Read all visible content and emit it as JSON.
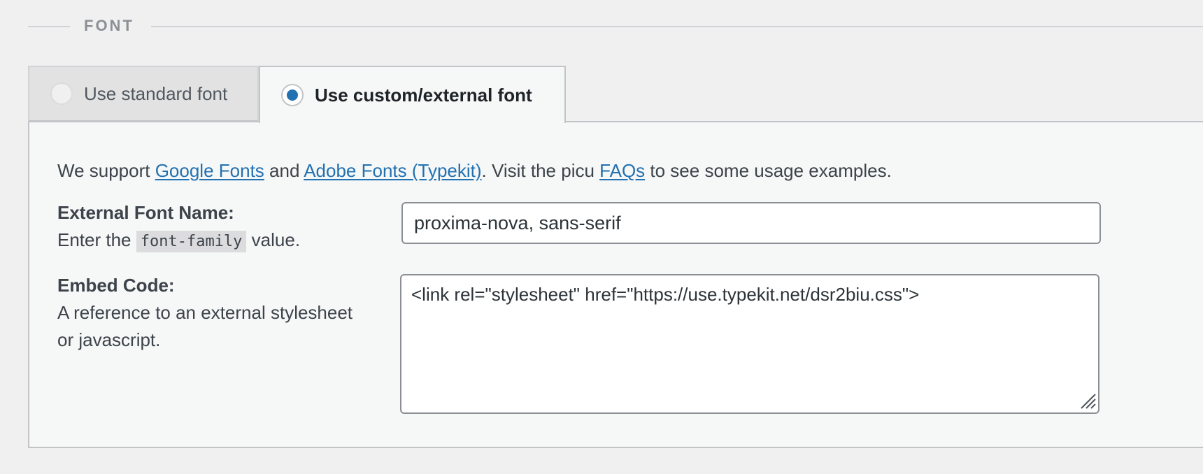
{
  "section": {
    "title": "FONT"
  },
  "tabs": [
    {
      "label": "Use standard font",
      "selected": false
    },
    {
      "label": "Use custom/external font",
      "selected": true
    }
  ],
  "intro": {
    "prefix": "We support ",
    "link_google": "Google Fonts",
    "and": " and ",
    "link_adobe": "Adobe Fonts (Typekit)",
    "middle": ". Visit the picu ",
    "link_faqs": "FAQs",
    "suffix": " to see some usage examples."
  },
  "font_name": {
    "label": "External Font Name:",
    "desc_prefix": "Enter the ",
    "desc_code": "font-family",
    "desc_suffix": " value.",
    "value": "proxima-nova, sans-serif"
  },
  "embed_code": {
    "label": "Embed Code:",
    "desc_line1": "A reference to an external stylesheet",
    "desc_line2": "or javascript.",
    "value": "<link rel=\"stylesheet\" href=\"https://use.typekit.net/dsr2biu.css\">"
  },
  "colors": {
    "link": "#2271b1",
    "radio_checked": "#2271b1",
    "background": "#f0f0f1",
    "panel": "#f6f7f7"
  },
  "icons": {
    "resize": "resize-handle-icon",
    "radio": "radio-icon"
  }
}
